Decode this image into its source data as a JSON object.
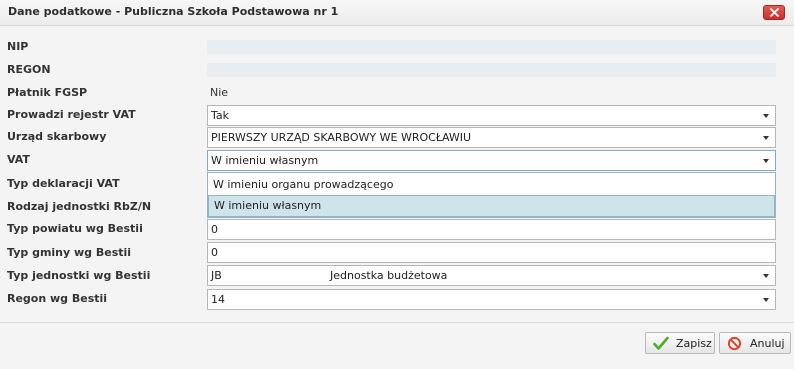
{
  "dialog": {
    "title": "Dane podatkowe - Publiczna Szkoła Podstawowa nr 1",
    "close_icon": "close-x-icon"
  },
  "form": {
    "nip": {
      "label": "NIP",
      "value": ""
    },
    "regon": {
      "label": "REGON",
      "value": ""
    },
    "platnik_fgsp": {
      "label": "Płatnik FGSP",
      "value": "Nie"
    },
    "rejestr_vat": {
      "label": "Prowadzi rejestr VAT",
      "value": "Tak"
    },
    "urzad": {
      "label": "Urząd skarbowy",
      "value": "PIERWSZY URZĄD SKARBOWY WE WROCŁAWIU"
    },
    "vat": {
      "label": "VAT",
      "value": "W imieniu własnym",
      "options": [
        "W imieniu organu prowadzącego",
        "W imieniu własnym"
      ],
      "selected_index": 1
    },
    "typ_deklaracji": {
      "label": "Typ deklaracji VAT"
    },
    "rodzaj_jednostki": {
      "label": "Rodzaj jednostki RbZ/N"
    },
    "typ_powiatu": {
      "label": "Typ powiatu wg Bestii",
      "value": "0"
    },
    "typ_gminy": {
      "label": "Typ gminy wg Bestii",
      "value": "0"
    },
    "typ_jednostki": {
      "label": "Typ jednostki wg Bestii",
      "code": "JB",
      "value": "Jednostka budżetowa"
    },
    "regon_bestii": {
      "label": "Regon wg Bestii",
      "value": "14"
    }
  },
  "footer": {
    "save_label": "Zapisz",
    "save_icon": "checkmark-icon",
    "cancel_label": "Anuluj",
    "cancel_icon": "cancel-icon"
  },
  "colors": {
    "readonly_bg": "#e8edf1",
    "selected_option_bg": "#cfe3ea",
    "close_button": "#d9403a",
    "save_check": "#4caf2a",
    "cancel_icon": "#d64a2b"
  }
}
